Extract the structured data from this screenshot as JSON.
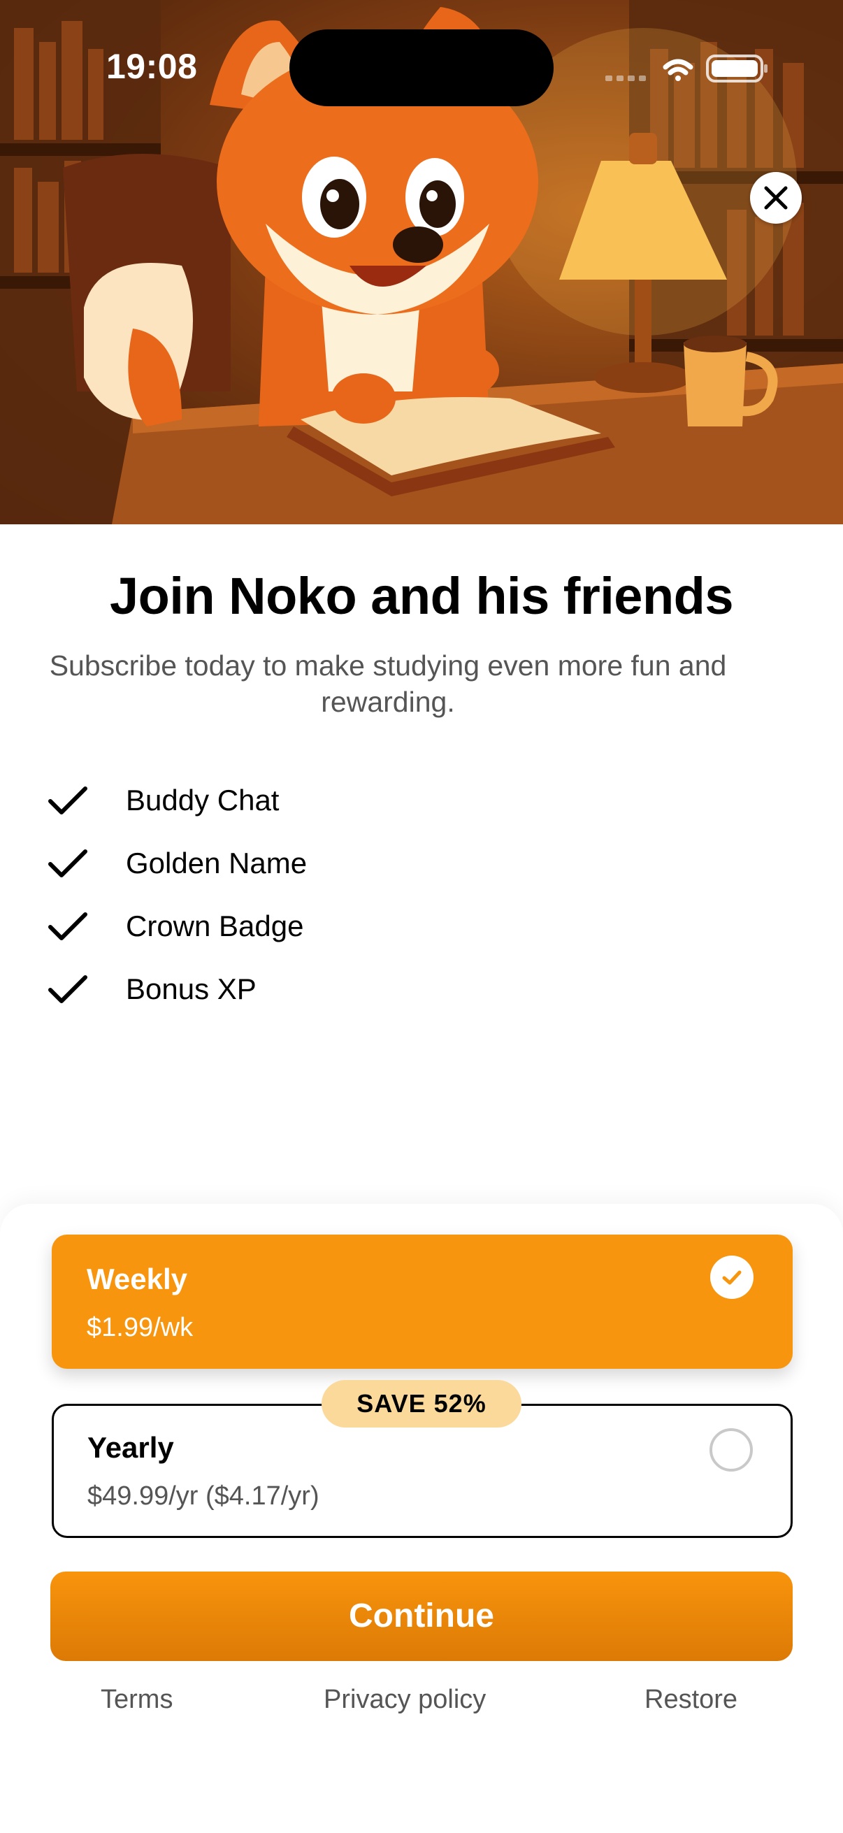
{
  "status_bar": {
    "time": "19:08"
  },
  "hero": {
    "close_icon": "close-icon"
  },
  "header": {
    "title": "Join Noko and his friends",
    "subtitle": "Subscribe today to make studying even more fun and rewarding."
  },
  "features": [
    {
      "label": "Buddy Chat",
      "icon": "checkmark-icon"
    },
    {
      "label": "Golden Name",
      "icon": "checkmark-icon"
    },
    {
      "label": "Crown Badge",
      "icon": "checkmark-icon"
    },
    {
      "label": "Bonus XP",
      "icon": "checkmark-icon"
    }
  ],
  "plans": {
    "weekly": {
      "name": "Weekly",
      "price": "$1.99/wk",
      "selected": true
    },
    "yearly": {
      "name": "Yearly",
      "price": "$49.99/yr ($4.17/yr)",
      "badge": "SAVE 52%",
      "selected": false
    }
  },
  "cta": {
    "label": "Continue"
  },
  "footer": {
    "terms": "Terms",
    "privacy": "Privacy policy",
    "restore": "Restore"
  },
  "colors": {
    "accent": "#f7960e",
    "badge": "#fbd99a",
    "text_secondary": "#555555"
  }
}
